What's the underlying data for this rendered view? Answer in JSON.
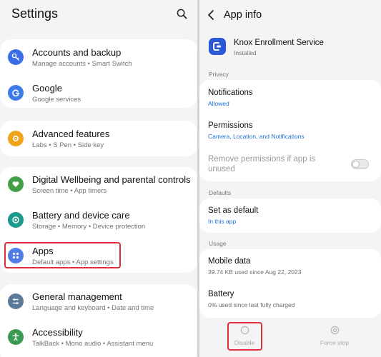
{
  "settings": {
    "title": "Settings",
    "groups": [
      {
        "items": [
          {
            "title": "Accounts and backup",
            "subtitle": "Manage accounts • Smart Switch",
            "icon": "key-icon",
            "color": "#3a6ee8"
          },
          {
            "title": "Google",
            "subtitle": "Google services",
            "icon": "google-icon",
            "color": "#3b7ce9"
          }
        ]
      },
      {
        "items": [
          {
            "title": "Advanced features",
            "subtitle": "Labs • S Pen • Side key",
            "icon": "gear-plus-icon",
            "color": "#f0a419"
          }
        ]
      },
      {
        "items": [
          {
            "title": "Digital Wellbeing and parental controls",
            "subtitle": "Screen time • App timers",
            "icon": "heart-icon",
            "color": "#43a047"
          },
          {
            "title": "Battery and device care",
            "subtitle": "Storage • Memory • Device protection",
            "icon": "device-care-icon",
            "color": "#1a9a8a"
          },
          {
            "title": "Apps",
            "subtitle": "Default apps • App settings",
            "icon": "apps-icon",
            "color": "#4f7ee6"
          }
        ]
      },
      {
        "items": [
          {
            "title": "General management",
            "subtitle": "Language and keyboard • Date and time",
            "icon": "sliders-icon",
            "color": "#5b7a9a"
          },
          {
            "title": "Accessibility",
            "subtitle": "TalkBack • Mono audio • Assistant menu",
            "icon": "accessibility-icon",
            "color": "#3a9a52"
          }
        ]
      }
    ]
  },
  "appinfo": {
    "title": "App info",
    "app_name": "Knox Enrollment Service",
    "app_status": "Installed",
    "sections": {
      "privacy": "Privacy",
      "defaults": "Defaults",
      "usage": "Usage"
    },
    "notifications": {
      "title": "Notifications",
      "value": "Allowed"
    },
    "permissions": {
      "title": "Permissions",
      "value": "Camera, Location, and Notifications"
    },
    "remove_permissions": {
      "title_line1": "Remove permissions if app is",
      "title_line2": "unused",
      "enabled": false
    },
    "set_default": {
      "title": "Set as default",
      "value": "In this app"
    },
    "mobile_data": {
      "title": "Mobile data",
      "value": "39.74 KB used since Aug 22, 2023"
    },
    "battery": {
      "title": "Battery",
      "value": "0% used since last fully charged"
    },
    "actions": {
      "disable": "Disable",
      "force_stop": "Force stop"
    }
  }
}
